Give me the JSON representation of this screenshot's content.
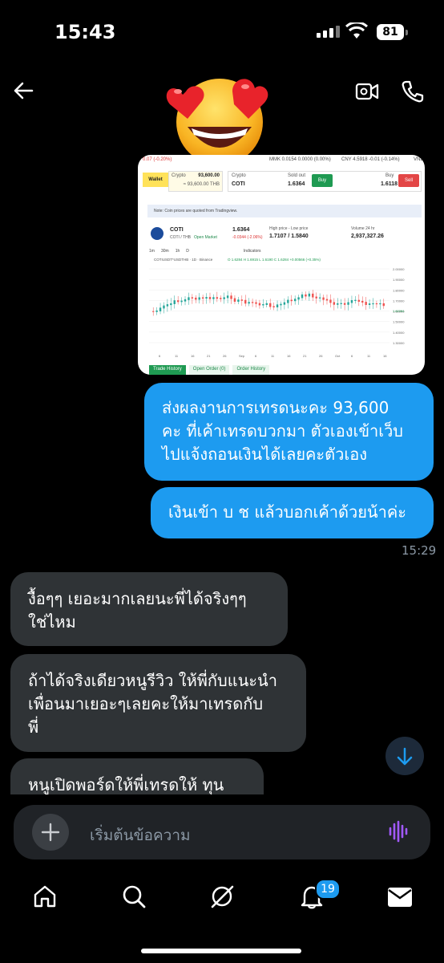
{
  "status_bar": {
    "time": "15:43",
    "battery": "81"
  },
  "messages": [
    {
      "dir": "out",
      "text_lines": [
        "ส่งผลงานการเทรดนะคะ 93,600",
        "คะ ที่เค้าเทรดบวกมา ตัวเองเข้าเว็บ",
        "ไปแจ้งถอนเงินได้เลยคะตัวเอง"
      ]
    },
    {
      "dir": "out",
      "text_lines": [
        "เงินเข้า บ ช แล้วบอกเค้าด้วยน้าค่ะ"
      ]
    },
    {
      "dir": "in",
      "text_lines": [
        "งื้อๆๆ  เยอะมากเลยนะพี่ได้จริงๆๆ",
        "ใช่ไหม"
      ]
    },
    {
      "dir": "in",
      "text_lines": [
        "ถ้าได้จริงเดียวหนูรีวิว ให้พี่กับแนะนำ",
        "เพื่อนมาเยอะๆเลยคะให้มาเทรดกับ",
        "พี่"
      ]
    },
    {
      "dir": "in",
      "text_lines": [
        "หนูเปิดพอร์ดให้พี่เทรดให้ ทุน"
      ]
    }
  ],
  "timestamp": "15:29",
  "composer": {
    "placeholder": "เริ่มต้นข้อความ"
  },
  "notifications_badge": "19",
  "shared_image": {
    "ticker_top": [
      "0.07 (-0.20%)",
      "MMK 0.0154  0.0000 (0.00%)",
      "CNY  4.5918  -0.01 (-0.14%)",
      "VND"
    ],
    "wallet_label": "Wallet",
    "crypto_label": "Crypto",
    "crypto_amount": "93,600.00",
    "thb_amount": "≈ 93,600.00 THB",
    "crypto2_label": "Crypto",
    "coin": "COTI",
    "sold_out_label": "Sold out",
    "sold_out_value": "1.6364",
    "buy_label": "Buy",
    "buy_value": "1.6118",
    "buy_button": "Buy",
    "sell_button": "Sell",
    "note": "Note: Coin prices are quoted from Tradingview.",
    "pair": "COTI / THB",
    "market_status": "Open Market",
    "price": "1.6364",
    "change": "-0.0344 (-2.06%)",
    "hl_label": "High price - Low price",
    "hl_value": "1.7107 / 1.5840",
    "volume_label": "Volume 24 hr",
    "volume_value": "2,937,327.26",
    "timeframes": [
      "1m",
      "30m",
      "1h",
      "D"
    ],
    "indicators": "Indicators",
    "chart_title": "COTIUSDT*USDTHB · 1D · Binance",
    "ohlc": "O 1.6284  H 1.6915  L 1.6190  C 1.6284  +0.00566 (+0.35%)",
    "yaxis": [
      "2.00000",
      "1.90000",
      "1.80000",
      "1.70000",
      "1.60000",
      "1.50000",
      "1.40000",
      "1.30000"
    ],
    "xaxis": [
      "6",
      "11",
      "16",
      "21",
      "26",
      "Sep",
      "6",
      "11",
      "16",
      "21",
      "26",
      "Oct",
      "6",
      "11",
      "16"
    ],
    "current_price_tag": "1.62284",
    "tabs": [
      "Trade History",
      "Open Order (0)",
      "Order History"
    ]
  }
}
